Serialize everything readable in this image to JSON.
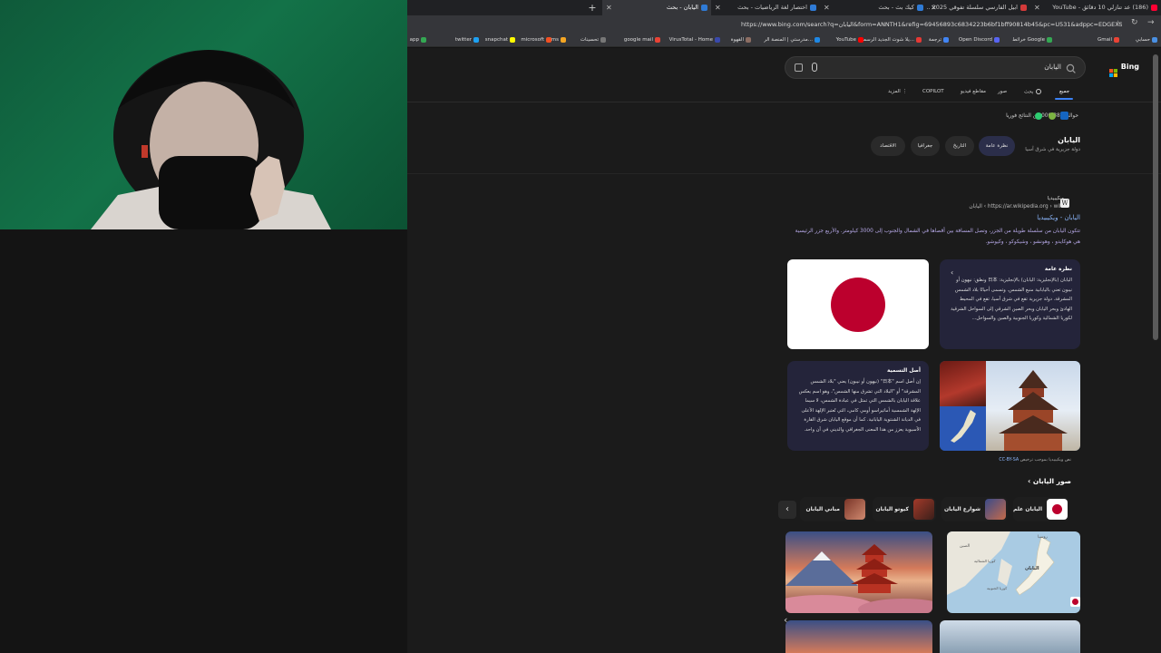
{
  "tabs": [
    {
      "title": "(186) عد تنازلي 10 دقائق - YouTube",
      "favicon_color": "#ff0033",
      "active": false
    },
    {
      "title": "ابيل الفارسي سلسلة تفوقي 2025 ...",
      "favicon_color": "#d43a3a",
      "active": false
    },
    {
      "title": "كيك بث - بحث",
      "favicon_color": "#2f7bd6",
      "active": false
    },
    {
      "title": "اختصار لغة الرياضيات - بحث",
      "favicon_color": "#2f7bd6",
      "active": false
    },
    {
      "title": "اليابان - بحث",
      "favicon_color": "#2f7bd6",
      "active": true
    }
  ],
  "new_tab_label": "+",
  "address": {
    "url": "https://www.bing.com/search?q=اليابان&form=ANNTH1&refig=69456893c6834223b6bf1bff90814b45&pc=U531&adppc=EDGEXST"
  },
  "bookmarks": [
    {
      "label": "حسابي",
      "color": "#4a90e2"
    },
    {
      "label": "Gmail",
      "color": "#ea4335"
    },
    {
      "label": "خرائط Google",
      "color": "#34a853"
    },
    {
      "label": "Open Discord",
      "color": "#5865f2"
    },
    {
      "label": "ترجمة",
      "color": "#4285f4"
    },
    {
      "label": "يلا شوت الجديد الرسمي...",
      "color": "#e53935"
    },
    {
      "label": "YouTube",
      "color": "#ff0000"
    },
    {
      "label": "مدرستي | المنصة الر...",
      "color": "#1e88e5"
    },
    {
      "label": "القهوة",
      "color": "#8d6e63"
    },
    {
      "label": "VirusTotal - Home",
      "color": "#3949ab"
    },
    {
      "label": "google mail",
      "color": "#ea4335"
    },
    {
      "label": "تحسينات",
      "color": "#777777"
    },
    {
      "label": "lms",
      "color": "#f5a623"
    },
    {
      "label": "microsoft",
      "color": "#f25022"
    },
    {
      "label": "snapchat",
      "color": "#fffc00"
    },
    {
      "label": "twitter",
      "color": "#1da1f2"
    },
    {
      "label": "app",
      "color": "#34a853"
    }
  ],
  "search": {
    "query": "اليابان",
    "logo": "Bing"
  },
  "nav_tabs": [
    "جميع",
    "بحث",
    "صور",
    "مقاطع فيديو",
    "COPILOT",
    "المزيد"
  ],
  "results_count": "حوالي 387-000 من النتائج فوريا",
  "entity": {
    "title": "اليابان",
    "subtitle": "دولة جزيرية في شرق آسيا",
    "pills": [
      "نظرة عامة",
      "التاريخ",
      "جغرافيا",
      "الاقتصاد"
    ]
  },
  "wiki_result": {
    "source_name": "ويكيبيديا",
    "source_url": "https://ar.wikipedia.org › wiki › اليابان",
    "title": "اليابان - ويكيبيديا",
    "snippet": "تتكون اليابان من سلسلة طويلة من الجزر، وتصل المسافة بين أقصاها في الشمال والجنوب إلى 3000 كيلومتر. والأربع جزر الرئيسية هي هوكايدو ، وهونشو ، وشيكوكو ، وكيوشو."
  },
  "overview_card": {
    "heading": "نظرة عامة",
    "text": "اليابان (بالإنجليزية: اليابان) بالإنجليزية: 日本 ونطق: نيهون أو نيبون تعني باليابانية منبع الشمس. وتسمى أحيانًا بلاد الشمس المشرقة. دولة جزيرية تقع في شرق آسيا، تقع في المحيط الهادئ وبحر اليابان وبحر الصين الشرقي إلى السواحل الشرقية لكوريا الشمالية وكوريا الجنوبية والصين والسواحل..."
  },
  "naming_card": {
    "heading": "أصل التسمية",
    "text": "إن أصل اسم \"日本\" (نيهون أو نيبون) يعني \"بلاد الشمس المشرقة\" أو \"البلاد التي تشرق منها الشمس\"، وهو اسم يعكس علاقة اليابان بالشمس التي تمثل في عبادة الشمس، لا سيما الإلهة الشمسية أماتيراسو أومي كامي، التي تُعتبر الإلهة الأعلى في الديانة الشنتوية اليابانية. كما أن موقع اليابان شرق القارة الآسيوية يعزز من هذا المعنى الجغرافي والديني في آن واحد."
  },
  "license": {
    "text": "نص ويكيبيديا بموجب ترخيص",
    "link": "CC-BY-SA"
  },
  "images_section": {
    "heading": "صور اليابان",
    "chips": [
      "اليابان علم",
      "شوارع اليابان",
      "كيوتو اليابان",
      "مباني اليابان"
    ]
  },
  "map_labels": [
    "روسيا",
    "الصين",
    "اليابان",
    "كوريا الشمالية",
    "كوريا الجنوبية"
  ]
}
